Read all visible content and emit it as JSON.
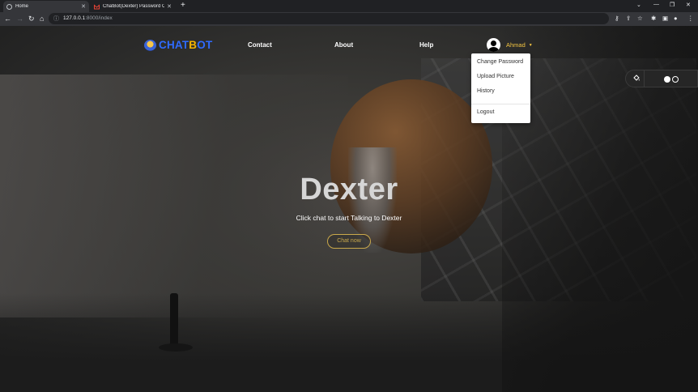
{
  "browser": {
    "tabs": [
      {
        "title": "Home",
        "active": true
      },
      {
        "title": "ChatBot(Dexter) Password Chang",
        "active": false
      }
    ],
    "new_tab": "+",
    "window_controls": [
      "⌄",
      "—",
      "❐",
      "✕"
    ],
    "url_host": "127.0.0.1",
    "url_path": ":8000/index"
  },
  "nav": {
    "logo_prefix": "CHAT",
    "logo_b": "B",
    "logo_suffix": "OT",
    "links": [
      "Contact",
      "About",
      "Help"
    ],
    "user_name": "Ahmad"
  },
  "dropdown": {
    "items": [
      "Change Password",
      "Upload Picture",
      "History"
    ],
    "logout": "Logout"
  },
  "hero": {
    "title": "Dexter",
    "subtitle": "Click chat to start Talking to Dexter",
    "button": "Chat now"
  },
  "colors": {
    "accent_gold": "#f4c542",
    "logo_blue": "#2f6bff",
    "button_gold": "#c9a84b"
  }
}
